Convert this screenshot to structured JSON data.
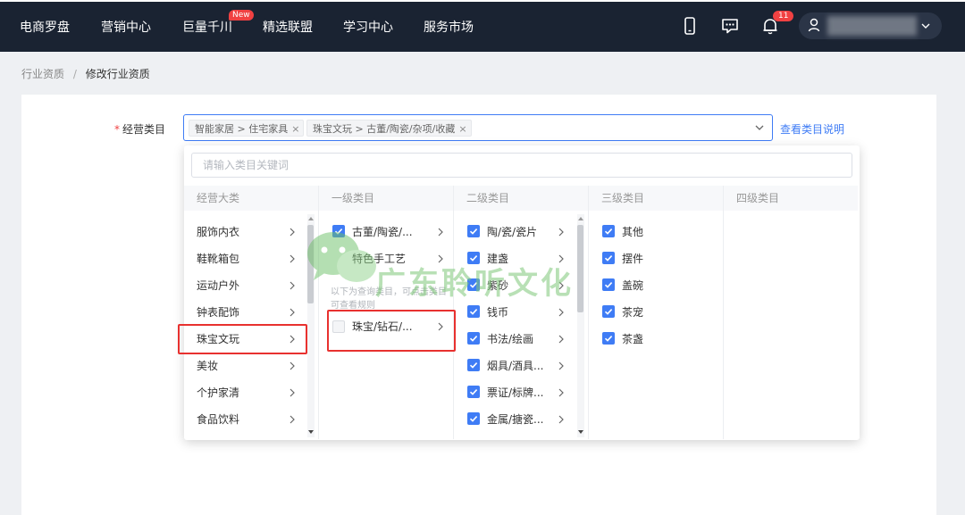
{
  "nav": {
    "items": [
      "电商罗盘",
      "营销中心",
      "巨量千川",
      "精选联盟",
      "学习中心",
      "服务市场"
    ],
    "new_badge": "New",
    "bell_count": "11"
  },
  "breadcrumb": {
    "parent": "行业资质",
    "separator": "/",
    "current": "修改行业资质"
  },
  "form": {
    "required_mark": "*",
    "label": "经营类目",
    "selected_tags": [
      "智能家居 > 住宅家具",
      "珠宝文玩 > 古董/陶瓷/杂项/收藏"
    ],
    "tag_close": "×",
    "help_link": "查看类目说明"
  },
  "dropdown": {
    "search_placeholder": "请输入类目关键词",
    "columns": [
      "经营大类",
      "一级类目",
      "二级类目",
      "三级类目",
      "四级类目"
    ],
    "major": [
      "服饰内衣",
      "鞋靴箱包",
      "运动户外",
      "钟表配饰",
      "珠宝文玩",
      "美妆",
      "个护家清",
      "食品饮料"
    ],
    "selected_major": "珠宝文玩",
    "level1": [
      {
        "label": "古董/陶瓷/...",
        "checked": true
      },
      {
        "label": "特色手工艺",
        "checked": false
      },
      {
        "label": "珠宝/钻石/...",
        "checked": false,
        "disabled": true
      }
    ],
    "level1_hint": "以下为查询类目，可点击类目可查看规则",
    "level2": [
      "陶/瓷/瓷片",
      "建盏",
      "紫砂",
      "钱币",
      "书法/绘画",
      "烟具/酒具...",
      "票证/标牌...",
      "金属/搪瓷..."
    ],
    "level3": [
      "其他",
      "摆件",
      "盖碗",
      "茶宠",
      "茶盏"
    ]
  },
  "watermark": {
    "text": "广东聆听文化"
  },
  "colors": {
    "nav_bg": "#1a2332",
    "accent": "#3f7cf5",
    "highlight": "#e8312f",
    "badge": "#f04142"
  }
}
